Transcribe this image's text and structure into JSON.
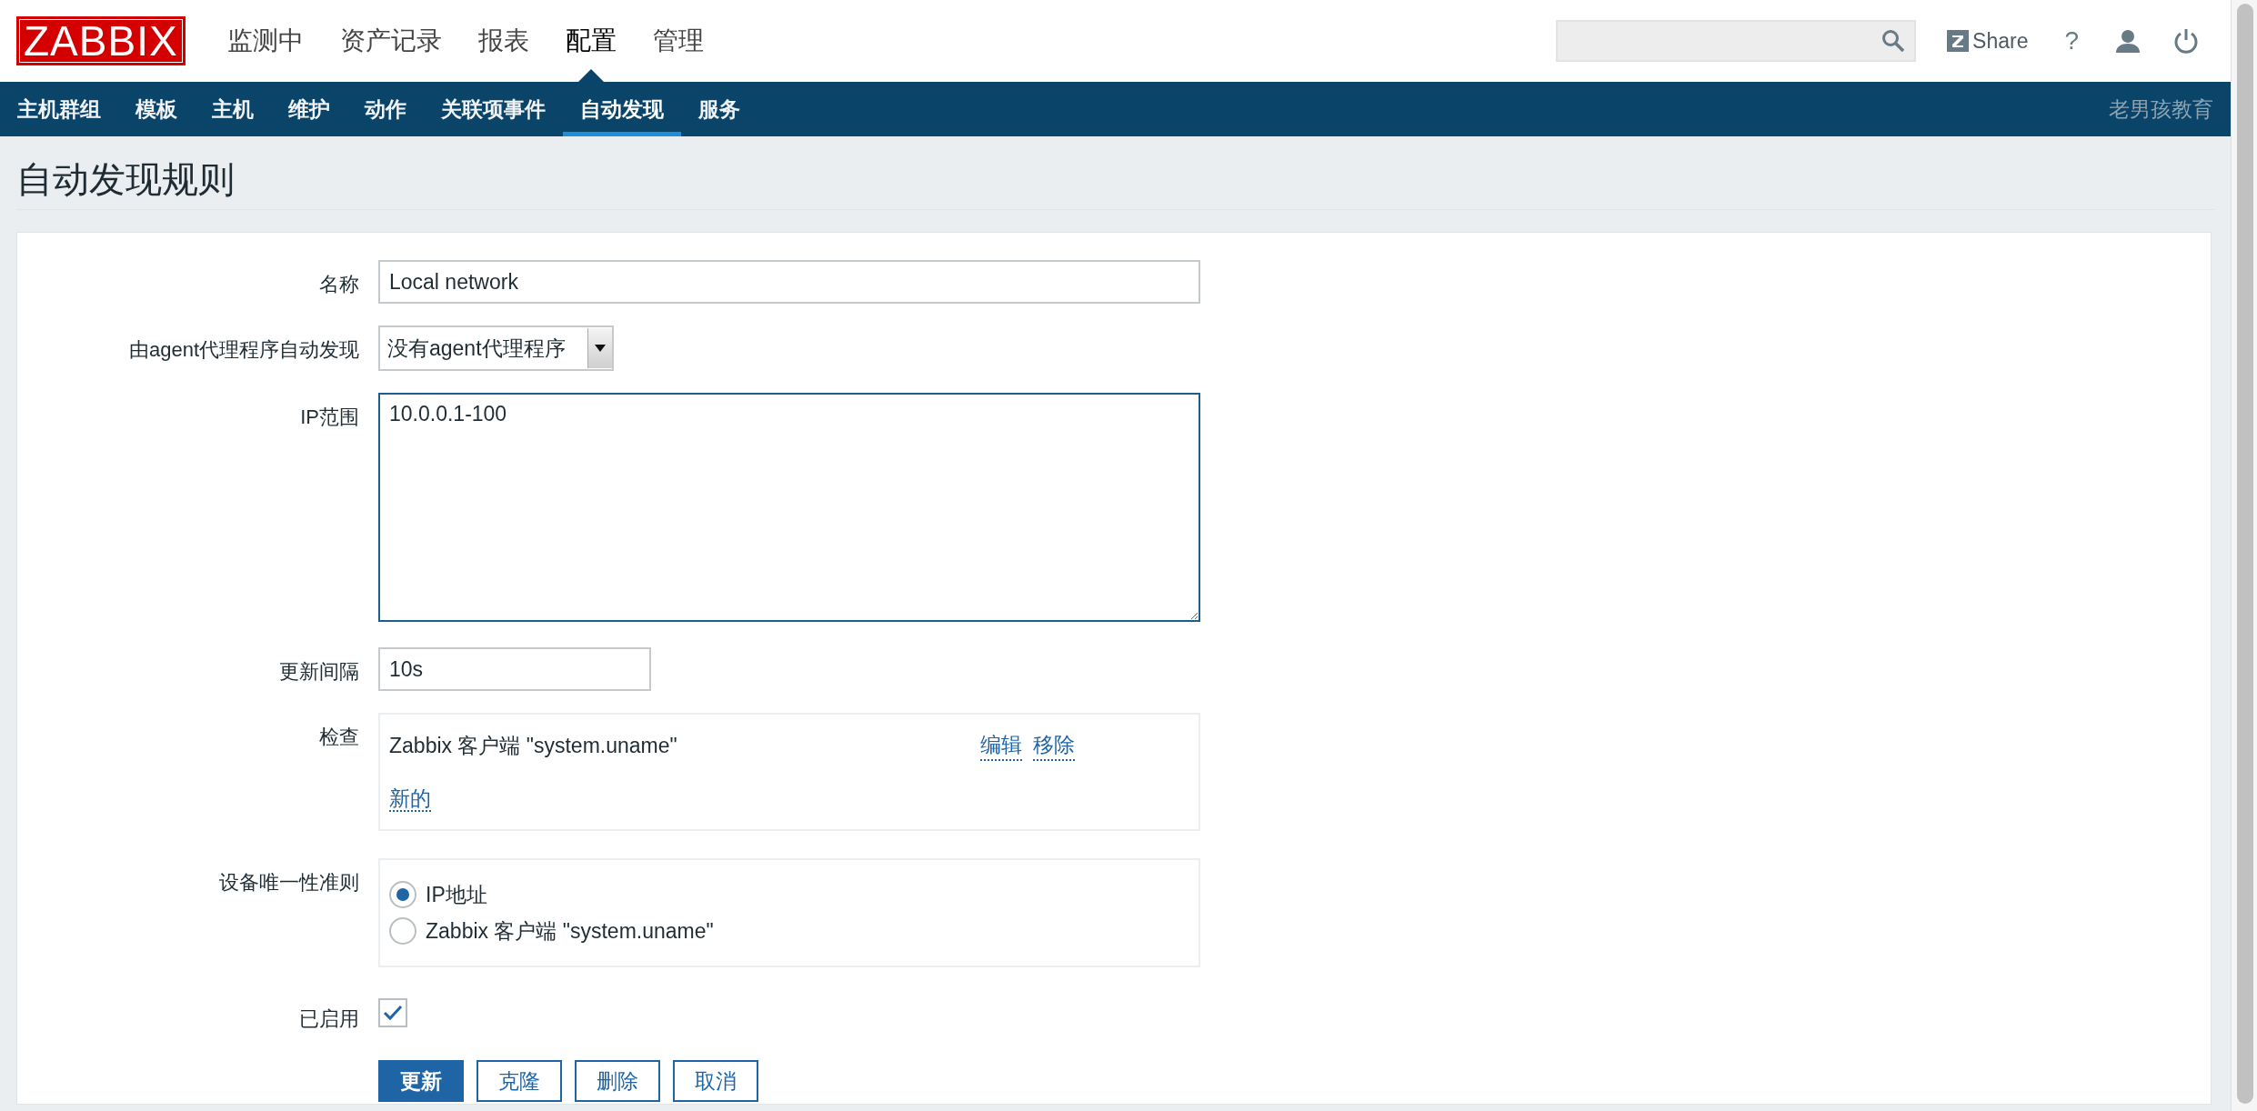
{
  "header": {
    "logo": "ZABBIX",
    "menu": [
      {
        "label": "监测中",
        "selected": false
      },
      {
        "label": "资产记录",
        "selected": false
      },
      {
        "label": "报表",
        "selected": false
      },
      {
        "label": "配置",
        "selected": true
      },
      {
        "label": "管理",
        "selected": false
      }
    ],
    "share": "Share",
    "help": "?"
  },
  "submenu": {
    "items": [
      {
        "label": "主机群组",
        "selected": false
      },
      {
        "label": "模板",
        "selected": false
      },
      {
        "label": "主机",
        "selected": false
      },
      {
        "label": "维护",
        "selected": false
      },
      {
        "label": "动作",
        "selected": false
      },
      {
        "label": "关联项事件",
        "selected": false
      },
      {
        "label": "自动发现",
        "selected": true
      },
      {
        "label": "服务",
        "selected": false
      }
    ],
    "brand": "老男孩教育"
  },
  "page_title": "自动发现规则",
  "form": {
    "name": {
      "label": "名称",
      "value": "Local network"
    },
    "proxy": {
      "label": "由agent代理程序自动发现",
      "value": "没有agent代理程序"
    },
    "ip_range": {
      "label": "IP范围",
      "value": "10.0.0.1-100"
    },
    "interval": {
      "label": "更新间隔",
      "value": "10s"
    },
    "checks": {
      "label": "检查",
      "items": [
        {
          "text": "Zabbix 客户端 \"system.uname\"",
          "actions": [
            "编辑",
            "移除"
          ]
        }
      ],
      "add_link": "新的"
    },
    "uniqueness": {
      "label": "设备唯一性准则",
      "options": [
        {
          "label": "IP地址",
          "selected": true
        },
        {
          "label": "Zabbix 客户端 \"system.uname\"",
          "selected": false
        }
      ]
    },
    "enabled": {
      "label": "已启用",
      "checked": true
    }
  },
  "buttons": [
    {
      "label": "更新",
      "kind": "primary"
    },
    {
      "label": "克隆",
      "kind": "secondary"
    },
    {
      "label": "删除",
      "kind": "secondary"
    },
    {
      "label": "取消",
      "kind": "secondary"
    }
  ]
}
